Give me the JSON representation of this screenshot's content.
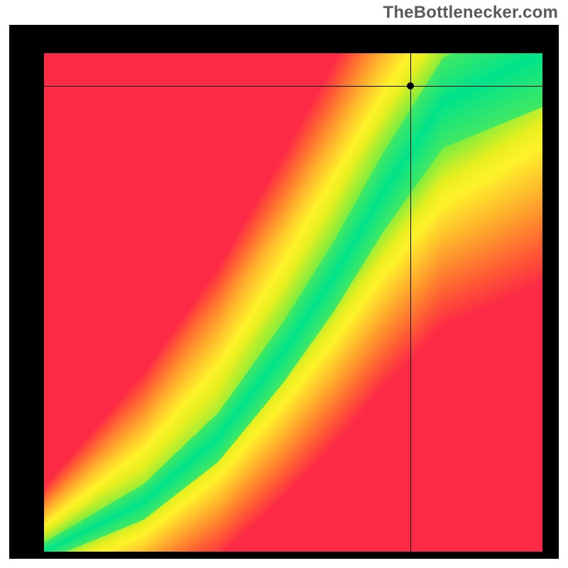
{
  "watermark": "TheBottlenecker.com",
  "chart_data": {
    "type": "heatmap",
    "title": "",
    "xlabel": "",
    "ylabel": "",
    "xlim": [
      0,
      1
    ],
    "ylim": [
      0,
      1
    ],
    "grid_size": 200,
    "crosshair": {
      "x": 0.735,
      "y": 0.935
    },
    "color_scale": [
      {
        "t": 0.0,
        "color": "#00e38a"
      },
      {
        "t": 0.15,
        "color": "#84ed3c"
      },
      {
        "t": 0.3,
        "color": "#e8ef1e"
      },
      {
        "t": 0.4,
        "color": "#fff22a"
      },
      {
        "t": 0.55,
        "color": "#ffc32c"
      },
      {
        "t": 0.7,
        "color": "#ff8f2d"
      },
      {
        "t": 0.85,
        "color": "#ff5a34"
      },
      {
        "t": 1.0,
        "color": "#fc2a45"
      }
    ],
    "model": {
      "desc": "score(x,y) is 0 (green) along a super-linear ridge y = f(x); increases toward 1 (red) away from ridge.",
      "ridge_control_points": [
        {
          "x": 0.0,
          "y": 0.0
        },
        {
          "x": 0.2,
          "y": 0.1
        },
        {
          "x": 0.35,
          "y": 0.23
        },
        {
          "x": 0.48,
          "y": 0.4
        },
        {
          "x": 0.58,
          "y": 0.55
        },
        {
          "x": 0.68,
          "y": 0.72
        },
        {
          "x": 0.8,
          "y": 0.9
        },
        {
          "x": 1.0,
          "y": 1.0
        }
      ],
      "ridge_width_base": 0.018,
      "ridge_width_growth": 0.09
    }
  }
}
